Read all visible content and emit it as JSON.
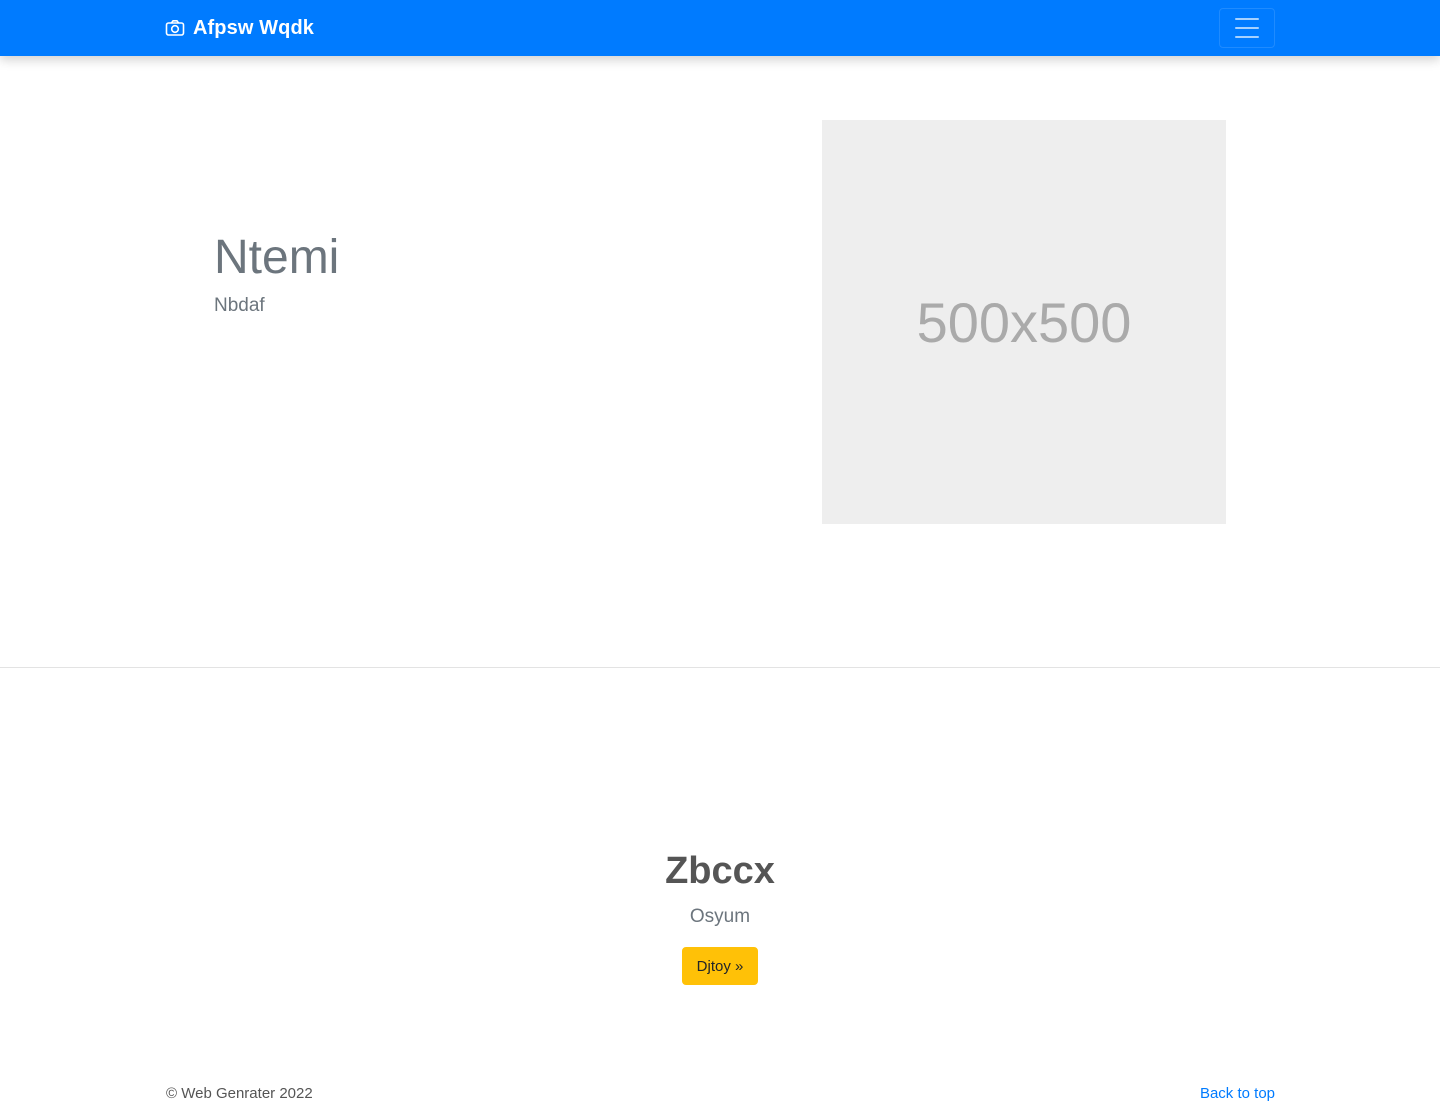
{
  "navbar": {
    "brand": "Afpsw Wqdk",
    "brand_icon": "camera-icon",
    "toggler_icon": "hamburger-menu-icon",
    "background": "#007bff"
  },
  "hero": {
    "title": "Ntemi",
    "subtitle": "Nbdaf",
    "image_placeholder": "500x500"
  },
  "cta": {
    "title": "Zbccx",
    "subtitle": "Osyum",
    "button_label": "Djtoy »",
    "button_color": "#ffc107"
  },
  "footer": {
    "copyright": "© Web Genrater 2022",
    "back_to_top": "Back to top",
    "link_color": "#007bff"
  }
}
